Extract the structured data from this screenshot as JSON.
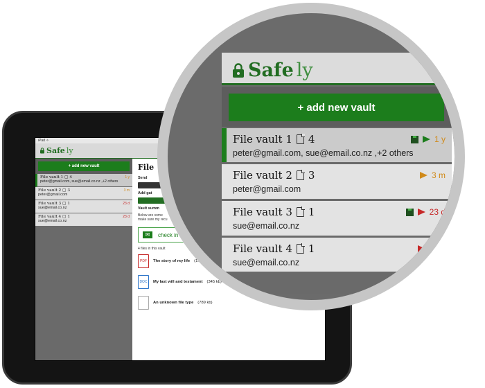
{
  "app": {
    "logo_main": "Safe",
    "logo_light": "ly",
    "add_vault_label": "+ add new vault"
  },
  "colors": {
    "brand_green": "#226d22",
    "button_green": "#1c7d1c",
    "orange": "#d08a1a",
    "red": "#c62828"
  },
  "vaults": [
    {
      "name": "File vault 1",
      "file_count": "4",
      "emails": "peter@gmail.com, sue@email.co.nz ,+2 others",
      "time": "1 y",
      "time_color": "#d08a1a",
      "locked": true,
      "selected": true
    },
    {
      "name": "File vault 2",
      "file_count": "3",
      "emails": "peter@gmail.com",
      "time": "3 m",
      "time_color": "#d08a1a",
      "locked": false,
      "selected": false
    },
    {
      "name": "File vault 3",
      "file_count": "1",
      "emails": "sue@email.co.nz",
      "time": "23 d",
      "time_color": "#c62828",
      "locked": true,
      "selected": false
    },
    {
      "name": "File vault 4",
      "file_count": "1",
      "emails": "sue@email.co.nz",
      "time": "23 d",
      "time_color": "#c62828",
      "locked": false,
      "selected": false
    }
  ],
  "small_vaults": [
    {
      "line1": "File vault 1 ▢ 4",
      "emails": "peter@gmail.com, sue@email.co.nz ,+2 others",
      "time": "1 y"
    },
    {
      "line1": "File vault 2 ▢ 3",
      "emails": "peter@gmail.com",
      "time": "3 m"
    },
    {
      "line1": "File vault 3 ▢ 1",
      "emails": "sue@email.co.nz",
      "time": "23 d"
    },
    {
      "line1": "File vault 4 ▢ 1",
      "emails": "sue@email.co.nz",
      "time": "23 d"
    }
  ],
  "detail": {
    "title": "File",
    "send_label": "Send",
    "add_label": "Add gat",
    "summary_label": "Vault summ",
    "summary_text": "Below are some",
    "summary_text2": "make sure my recu",
    "check_in": "check in",
    "files_count": "4 files in this vault",
    "files": [
      {
        "name": "The story of my life",
        "size": "(1.2 m",
        "type": "PDF"
      },
      {
        "name": "My last will and testament",
        "size": "(345 kb)",
        "type": "DOC"
      },
      {
        "name": "An unknown file type",
        "size": "(789 kb)",
        "type": ""
      }
    ]
  },
  "right_panel": {
    "letter1": "Se",
    "letter2": "Ad",
    "dash": "–"
  },
  "status_bar": "iPad  ✧"
}
